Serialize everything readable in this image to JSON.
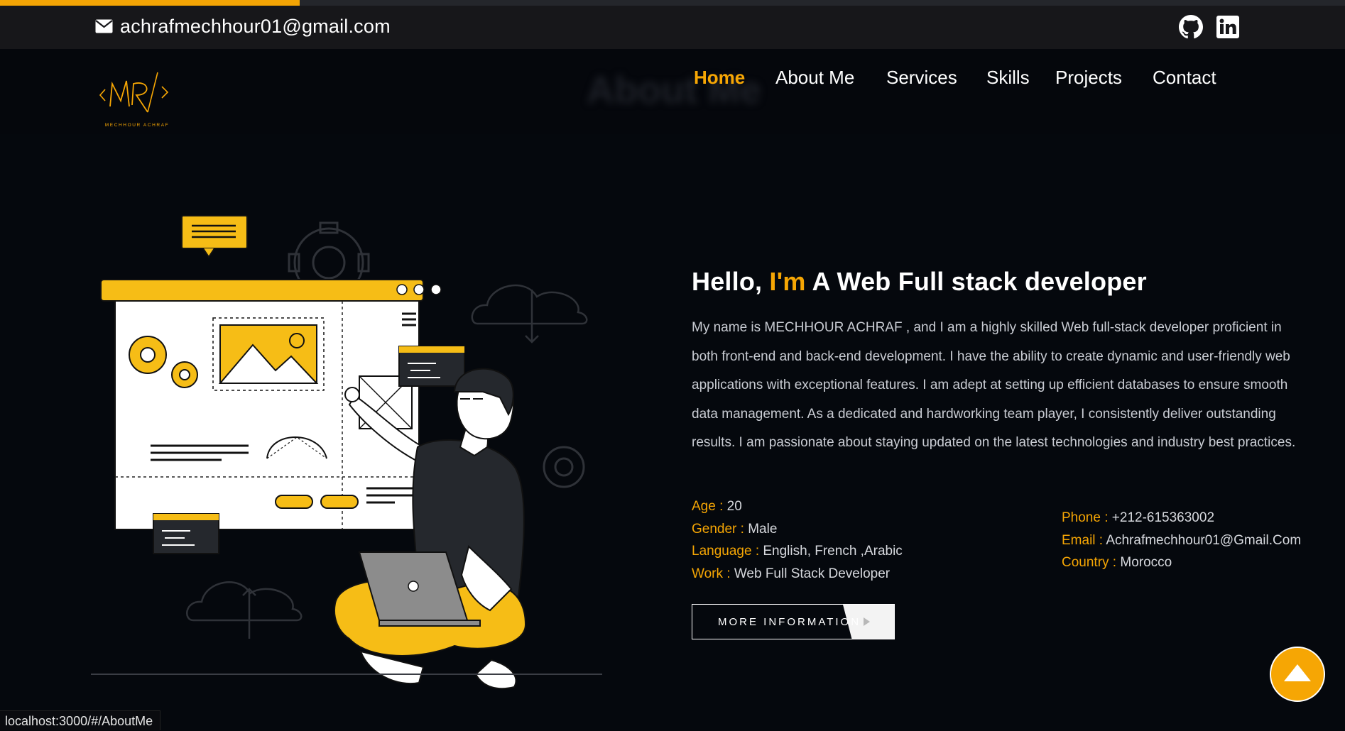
{
  "page": {
    "scroll_progress": 0.223
  },
  "topbar": {
    "email": "achrafmechhour01@gmail.com",
    "email_icon": "envelope-icon",
    "social_links": [
      {
        "name": "github",
        "icon": "github-icon"
      },
      {
        "name": "linkedin",
        "icon": "linkedin-icon"
      }
    ]
  },
  "header": {
    "logo_text": "MR",
    "logo_subtitle": "MECHHOUR ACHRAF",
    "ghost_title": "About Me",
    "nav": [
      {
        "label": "Home",
        "active": true
      },
      {
        "label": "About Me",
        "active": false
      },
      {
        "label": "Services",
        "active": false
      },
      {
        "label": "Skills",
        "active": false
      },
      {
        "label": "Projects",
        "active": false
      },
      {
        "label": "Contact",
        "active": false
      }
    ]
  },
  "about": {
    "headline_prefix": "Hello,",
    "headline_accent": "I'm",
    "headline_suffix": "A Web Full stack developer",
    "bio": "My name is MECHHOUR ACHRAF , and I am a highly skilled Web full-stack developer proficient in both front-end and back-end development. I have the ability to create dynamic and user-friendly web applications with exceptional features. I am adept at setting up efficient databases to ensure smooth data management. As a dedicated and hardworking team player, I consistently deliver outstanding results. I am passionate about staying updated on the latest technologies and industry best practices.",
    "facts_left": [
      {
        "key": "Age :",
        "value": "20"
      },
      {
        "key": "Gender :",
        "value": "Male"
      },
      {
        "key": "Language :",
        "value": "English, French ,Arabic"
      },
      {
        "key": "Work :",
        "value": "Web Full Stack Developer"
      }
    ],
    "facts_right": [
      {
        "key": "Phone :",
        "value": "+212-615363002"
      },
      {
        "key": "Email :",
        "value": "Achrafmechhour01@Gmail.Com"
      },
      {
        "key": "Country :",
        "value": "Morocco"
      }
    ],
    "more_button": "MORE INFORMATION"
  },
  "statusbar": {
    "url": "localhost:3000/#/AboutMe"
  },
  "colors": {
    "accent": "#f6a604",
    "background": "#05080d",
    "topbar": "#17171a"
  }
}
